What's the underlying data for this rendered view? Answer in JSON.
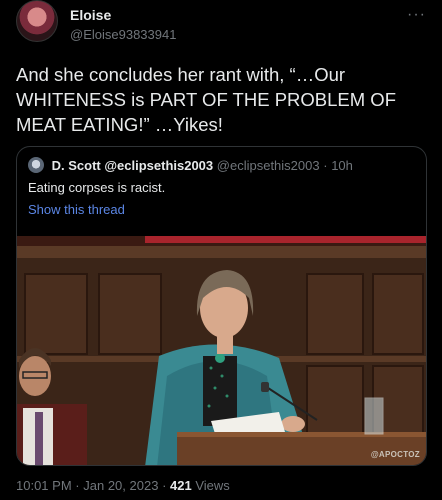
{
  "author": {
    "display_name": "Eloise",
    "handle": "@Eloise93833941"
  },
  "tweet": {
    "text_line1": "And she concludes her rant with, “…Our",
    "text_line2": "WHITENESS is PART OF THE PROBLEM OF",
    "text_line3": "MEAT EATING!” …Yikes!"
  },
  "more_label": "···",
  "quoted": {
    "display_name": "D. Scott @eclipsethis2003",
    "handle": "@eclipsethis2003",
    "separator": "·",
    "time": "10h",
    "text": "Eating corpses is racist.",
    "show_thread": "Show this thread",
    "watermark": "@APOCTOZ"
  },
  "meta": {
    "time": "10:01 PM",
    "sep1": "·",
    "date": "Jan 20, 2023",
    "sep2": "·",
    "views_count": "421",
    "views_label": "Views"
  }
}
